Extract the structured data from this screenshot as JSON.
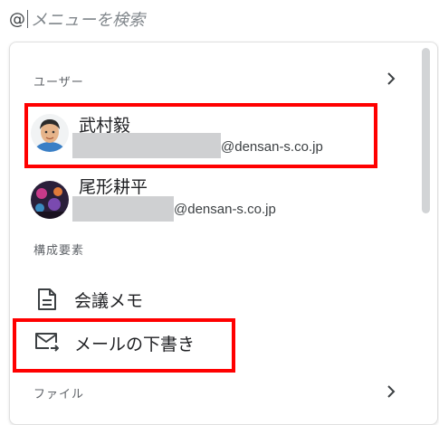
{
  "search": {
    "prefix": "@",
    "placeholder": "メニューを検索"
  },
  "sections": {
    "users": {
      "label": "ユーザー"
    },
    "components": {
      "label": "構成要素"
    },
    "files": {
      "label": "ファイル"
    }
  },
  "users": [
    {
      "name": "武村毅",
      "email_domain": "@densan-s.co.jp"
    },
    {
      "name": "尾形耕平",
      "email_domain": "@densan-s.co.jp"
    }
  ],
  "components": [
    {
      "label": "会議メモ",
      "icon": "document-icon"
    },
    {
      "label": "メールの下書き",
      "icon": "mail-draft-icon"
    }
  ],
  "colors": {
    "highlight": "#ff0000",
    "redaction": "#cfd0d2"
  }
}
